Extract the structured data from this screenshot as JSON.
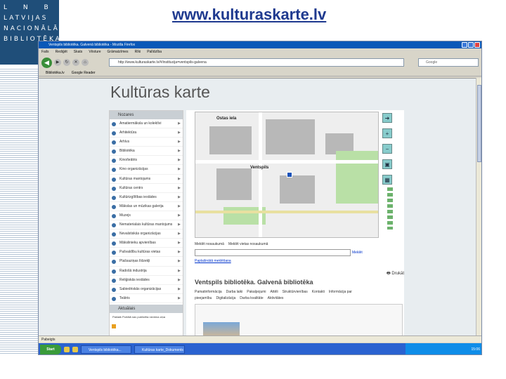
{
  "slide": {
    "url_title": "www.kulturaskarte.lv",
    "logo_lines": [
      "L N B",
      "LATVIJAS",
      "NACIONĀLĀ",
      "BIBLIOTĒKA"
    ]
  },
  "browser": {
    "window_title": "Ventspils bibliotēka. Galvenā bibliotēka - Mozilla Firefox",
    "menu": [
      "Fails",
      "Rediģēt",
      "Skats",
      "Vēsture",
      "Grāmatzīmes",
      "Rīki",
      "Palīdzība"
    ],
    "address": "http://www.kulturaskarte.lv/#/institucija=ventspils-galvena",
    "search_placeholder": "Google",
    "bookmarks": [
      "Bibliotēka.lv",
      "Google Reader"
    ],
    "status": "Pabeigts"
  },
  "page": {
    "title": "Kultūras karte",
    "sidebar_header": "Nozares",
    "sidebar_items": [
      "Amatiermāksla un kolektīvi",
      "Arhitektūra",
      "Arhīvs",
      "Bibliotēka",
      "Kino/teātris",
      "Kino organizācijas",
      "Kultūras mantojums",
      "Kultūras centrs",
      "Kultūrizglītības iestādes",
      "Mākslas un mūzikas galerija",
      "Muzejs",
      "Nematerialais kultūras mantojums",
      "Nevalstiskās organizācijas",
      "Mākslinieku apvienības",
      "Pašvaldību kultūras vietas",
      "Plašsaziņas līdzekļi",
      "Radošā industrija",
      "Reliģiskās iestādes",
      "Sabiedriskās organizācijas",
      "Teātris"
    ],
    "sidebar_aktual": "Aktuālais",
    "sidebar_note": "Pašlaik Portālā nav publicēta neviena ziņa",
    "map_labels": [
      "Ostas iela",
      "Ventspils"
    ],
    "search_label": "Meklēt nosaukumā",
    "search_hint": "Meklēt vietas nosaukumā",
    "search_button": "Meklēt",
    "extended_search": "Paplašinātā meklēšana",
    "print": "Drukāt",
    "institution_title": "Ventspils bibliotēka. Galvenā bibliotēka",
    "institution_tabs": [
      "Pamatinformācija",
      "Darba laiki",
      "Pakalpojumi",
      "Attēli",
      "Struktūrvienības",
      "Kontakti",
      "Informācija par pieejamību",
      "Digitalizācija",
      "Darba kvalitāte",
      "Aktivitātes"
    ]
  },
  "taskbar": {
    "start": "Start",
    "items": [
      "Ventspils bibliotēka...",
      "Kultūras karte_Dokuments"
    ],
    "time": "15:06"
  },
  "colors": {
    "logo_bg": "#1f4e79",
    "title_link": "#1f3a8f",
    "titlebar": "#0a58b8",
    "taskbar": "#2a62d0"
  }
}
